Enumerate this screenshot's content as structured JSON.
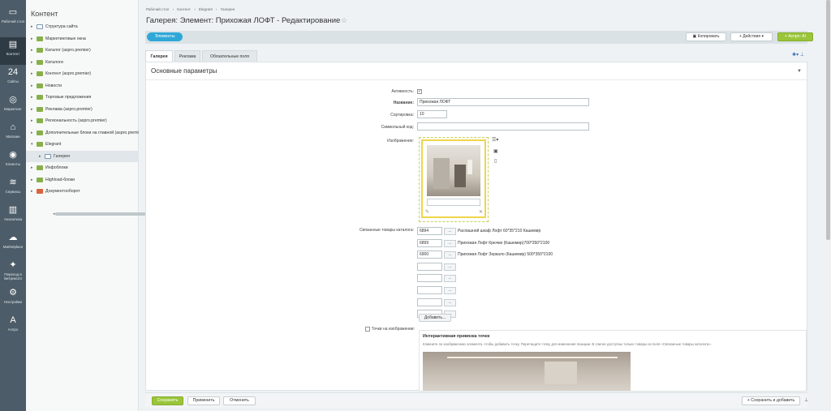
{
  "rail": [
    {
      "icon": "desktop-icon",
      "glyph": "▭",
      "label": "Рабочий стол"
    },
    {
      "icon": "content-icon",
      "glyph": "▤",
      "label": "Контент"
    },
    {
      "icon": "calendar-icon",
      "glyph": "24",
      "label": "Сайты"
    },
    {
      "icon": "target-icon",
      "glyph": "◎",
      "label": "Маркетинг"
    },
    {
      "icon": "shop-icon",
      "glyph": "⌂",
      "label": "Магазин"
    },
    {
      "icon": "clients-icon",
      "glyph": "◉",
      "label": "Клиенты"
    },
    {
      "icon": "layers-icon",
      "glyph": "≋",
      "label": "Сервисы"
    },
    {
      "icon": "chart-icon",
      "glyph": "▥",
      "label": "Аналитика"
    },
    {
      "icon": "cloud-icon",
      "glyph": "☁",
      "label": "Marketplace"
    },
    {
      "icon": "star-move-icon",
      "glyph": "✦",
      "label": "Переход в Битрикс24"
    },
    {
      "icon": "settings-icon",
      "glyph": "⚙",
      "label": "Настройки"
    },
    {
      "icon": "aspro-icon",
      "glyph": "A",
      "label": "Аспро"
    }
  ],
  "tree": {
    "title": "Контент",
    "items": [
      {
        "label": "Структура сайта",
        "level": 0,
        "type": "page",
        "arrow": "▸"
      },
      {
        "label": "Маркетинговые окна",
        "level": 0,
        "type": "folder",
        "arrow": "▸"
      },
      {
        "label": "Каталог (aspro.premier)",
        "level": 0,
        "type": "folder",
        "arrow": "▸"
      },
      {
        "label": "Каталоги",
        "level": 0,
        "type": "folder",
        "arrow": "▸"
      },
      {
        "label": "Контент (aspro.premier)",
        "level": 0,
        "type": "folder",
        "arrow": "▸"
      },
      {
        "label": "Новости",
        "level": 0,
        "type": "folder",
        "arrow": "▸"
      },
      {
        "label": "Торговые предложения",
        "level": 0,
        "type": "folder",
        "arrow": "▸"
      },
      {
        "label": "Реклама (aspro.premier)",
        "level": 0,
        "type": "folder",
        "arrow": "▸"
      },
      {
        "label": "Региональность (aspro.premier)",
        "level": 0,
        "type": "folder",
        "arrow": "▸"
      },
      {
        "label": "Дополнительные блоки на главной (aspro.premier)",
        "level": 0,
        "type": "folder",
        "arrow": "▸"
      },
      {
        "label": "Elegrant",
        "level": 0,
        "type": "folder",
        "arrow": "▾"
      },
      {
        "label": "Галерея",
        "level": 1,
        "type": "page",
        "arrow": "▸",
        "selected": true
      },
      {
        "label": "Инфоблоки",
        "level": 0,
        "type": "folder",
        "arrow": "▸"
      },
      {
        "label": "Highload-блоки",
        "level": 0,
        "type": "folder",
        "arrow": "▸"
      },
      {
        "label": "Документооборот",
        "level": 0,
        "type": "doc",
        "arrow": "▸"
      }
    ]
  },
  "breadcrumb": [
    "Рабочий стол",
    "›",
    "Контент",
    "›",
    "Elegrant",
    "›",
    "Галерея"
  ],
  "page_title": "Галерея: Элемент: Прихожая ЛОФТ - Редактирование",
  "toolbar": {
    "elements": "Элементы",
    "copy": "Копировать",
    "actions": "Действия",
    "aspro_ai": "Аспро: AI"
  },
  "tabs": [
    "Галерея",
    "Реклама",
    "Обязательные поля"
  ],
  "section_title": "Основные параметры",
  "form": {
    "active_label": "Активность:",
    "active_check": "✓",
    "name_label": "Название:",
    "name_value": "Прихожая ЛОФТ",
    "sort_label": "Сортировка:",
    "sort_value": "10",
    "code_label": "Символьный код:",
    "code_value": "",
    "image_label": "Изображение:",
    "linked_label": "Связанные товары каталога:",
    "linked": [
      {
        "id": "6894",
        "name": "Распашной шкаф Лофт 60*35*210 Кашемир"
      },
      {
        "id": "6899",
        "name": "Прихожая Лофт Крючки (Кашемир)700*350*2100"
      },
      {
        "id": "6900",
        "name": "Прихожая Лофт Зеркало (Кашемир) 500*350*2100"
      },
      {
        "id": "",
        "name": ""
      },
      {
        "id": "",
        "name": ""
      },
      {
        "id": "",
        "name": ""
      },
      {
        "id": "",
        "name": ""
      },
      {
        "id": "",
        "name": ""
      }
    ],
    "dots": "...",
    "add_button": "Добавить...",
    "points_label": "Точки на изображении:",
    "points_title": "Интерактивная привязка точек",
    "points_desc": "Кликните по изображению элемента, чтобы добавить точку. Перетащите точку для изменения позиции. В списке доступны только товары из поля «Связанные товары каталога»."
  },
  "footer": {
    "save": "Сохранить",
    "apply": "Применить",
    "cancel": "Отменить",
    "save_add": "Сохранить и добавить"
  }
}
